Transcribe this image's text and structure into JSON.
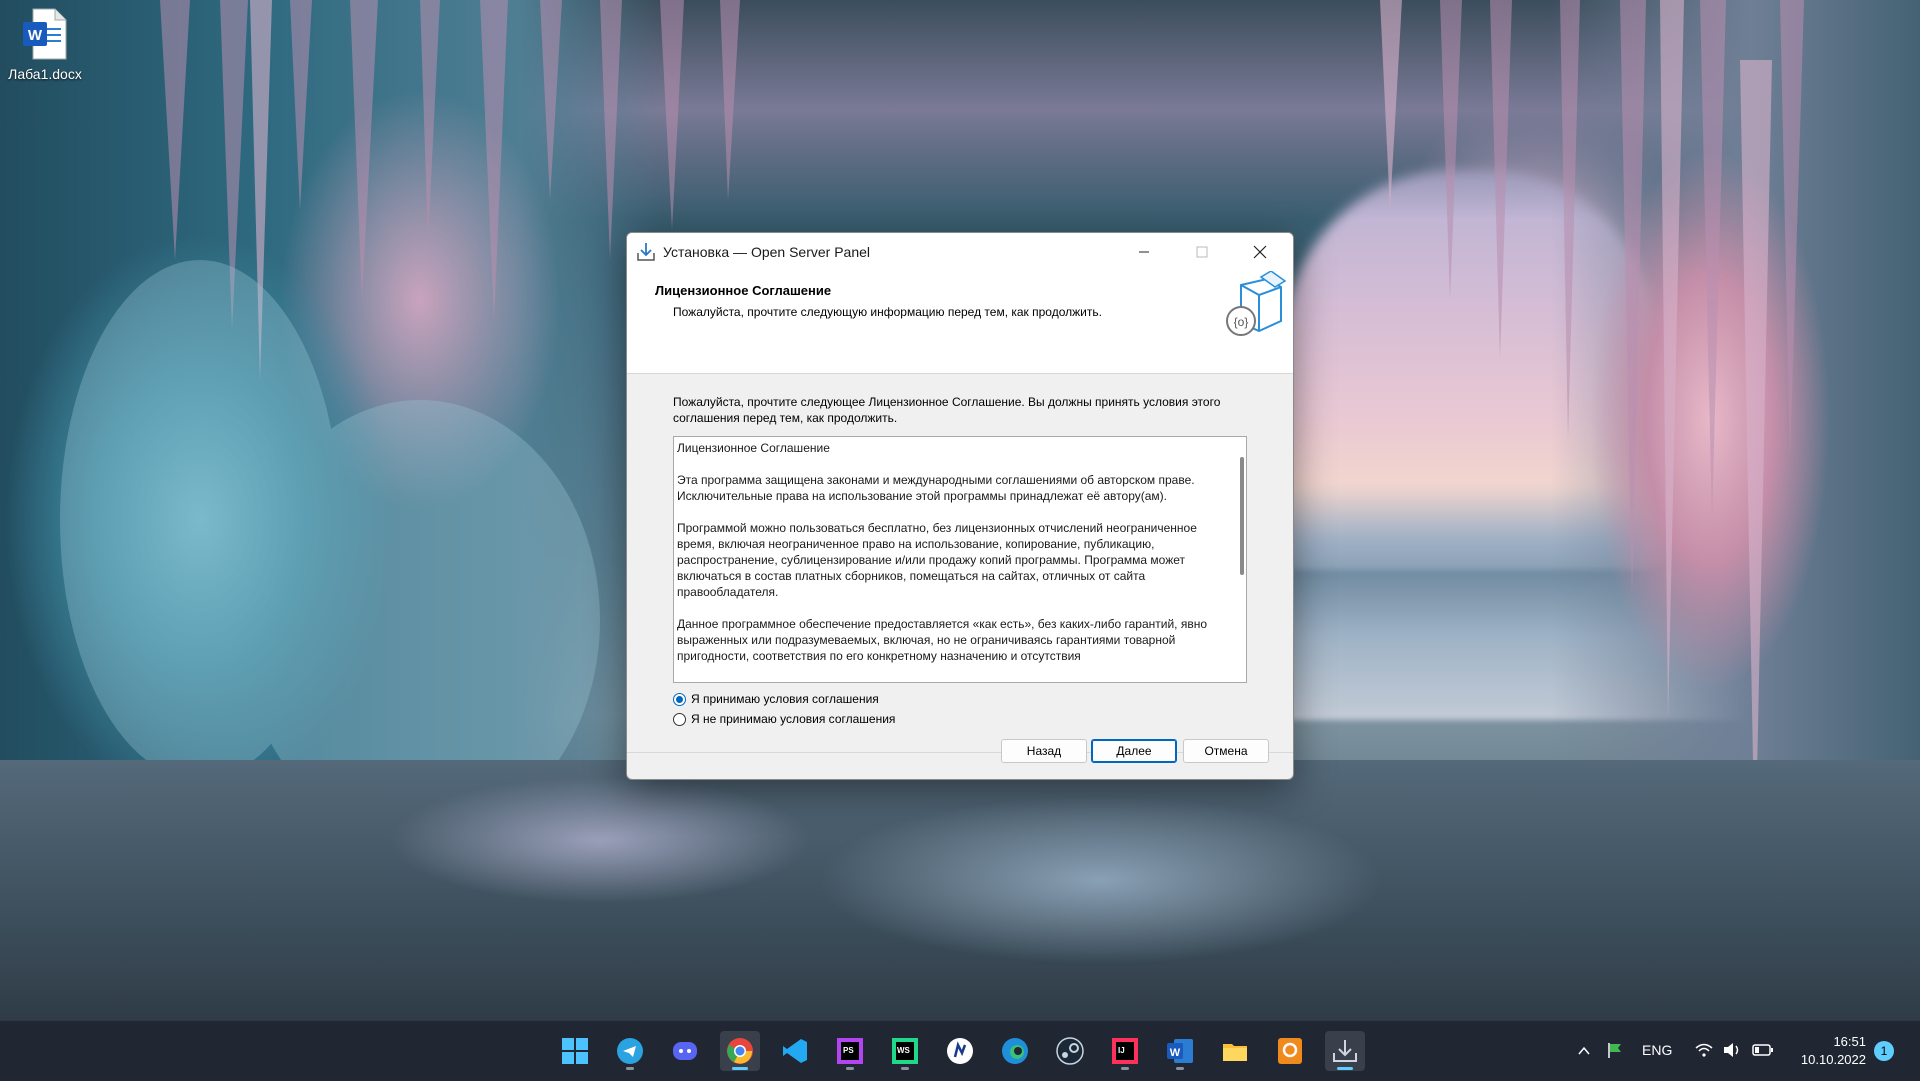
{
  "desktop": {
    "icons": [
      {
        "label": "Лаба1.docx",
        "icon": "word-document-icon"
      }
    ]
  },
  "window": {
    "title": "Установка — Open Server Panel",
    "header_title": "Лицензионное Соглашение",
    "header_subtitle": "Пожалуйста, прочтите следующую информацию перед тем, как продолжить.",
    "intro": "Пожалуйста, прочтите следующее Лицензионное Соглашение. Вы должны принять условия этого соглашения перед тем, как продолжить.",
    "license_paragraphs": [
      "Лицензионное Соглашение",
      "Эта программа защищена законами и международными соглашениями об авторском праве. Исключительные права на использование этой программы принадлежат её автору(ам).",
      "Программой можно пользоваться бесплатно, без лицензионных отчислений неограниченное время, включая неограниченное право на использование, копирование, публикацию, распространение, сублицензирование и/или продажу копий программы. Программа может включаться в состав платных сборников, помещаться на сайтах, отличных от сайта правообладателя.",
      "Данное программное обеспечение предоставляется «как есть», без каких-либо гарантий, явно выраженных или подразумеваемых, включая, но не ограничиваясь гарантиями товарной пригодности, соответствия по его конкретному назначению и отсутствия"
    ],
    "radio_accept": "Я принимаю условия соглашения",
    "radio_decline": "Я не принимаю условия соглашения",
    "accept_selected": true,
    "buttons": {
      "back": "Назад",
      "next": "Далее",
      "cancel": "Отмена"
    }
  },
  "taskbar": {
    "apps": [
      "start-icon",
      "telegram-icon",
      "discord-icon",
      "chrome-icon",
      "vscode-icon",
      "phpstorm-icon",
      "webstorm-icon",
      "app-icon",
      "edge-icon",
      "steam-icon",
      "intellij-icon",
      "word-icon",
      "file-explorer-icon",
      "pdf-app-icon",
      "installer-icon"
    ],
    "tray": {
      "language": "ENG",
      "time": "16:51",
      "date": "10.10.2022",
      "notifications": "1"
    }
  },
  "colors": {
    "accent": "#0067c0",
    "taskbar_bg": "#202733",
    "indicator": "#60cdff"
  }
}
